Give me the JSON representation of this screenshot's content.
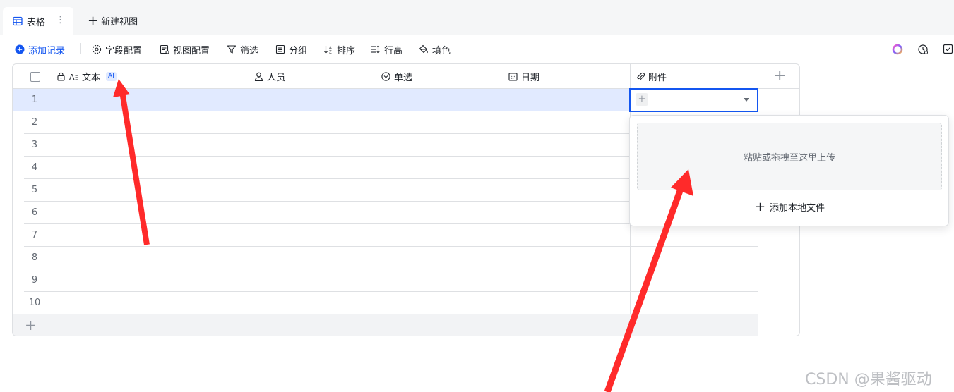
{
  "tabs": {
    "active_label": "表格",
    "more_glyph": "⋮",
    "new_view_label": "新建视图"
  },
  "toolbar": {
    "add_record": "添加记录",
    "field_config": "字段配置",
    "view_config": "视图配置",
    "filter": "筛选",
    "group": "分组",
    "sort": "排序",
    "row_height": "行高",
    "fill_color": "填色",
    "right_icons": [
      "color-palette-icon",
      "history-icon",
      "checklist-icon"
    ]
  },
  "grid": {
    "columns": [
      {
        "label": "文本",
        "icon": "text-icon",
        "ai_badge": "AI",
        "locked": true
      },
      {
        "label": "人员",
        "icon": "person-icon"
      },
      {
        "label": "单选",
        "icon": "single-select-icon"
      },
      {
        "label": "日期",
        "icon": "calendar-icon"
      },
      {
        "label": "附件",
        "icon": "paperclip-icon"
      }
    ],
    "row_numbers": [
      "1",
      "2",
      "3",
      "4",
      "5",
      "6",
      "7",
      "8",
      "9",
      "10"
    ],
    "add_row_glyph": "+",
    "add_column_glyph": "+"
  },
  "attachment_popover": {
    "dropzone_text": "粘贴或拖拽至这里上传",
    "add_local_label": "添加本地文件"
  },
  "watermark": "CSDN @果酱驱动",
  "colors": {
    "accent": "#1456f0",
    "selected_row": "#e1eaff",
    "arrow": "#ff2a2a"
  }
}
